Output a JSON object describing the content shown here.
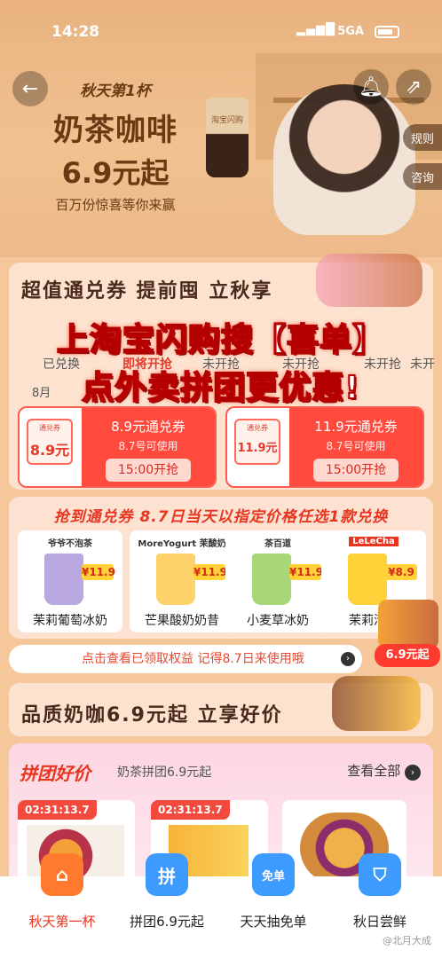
{
  "status": {
    "time": "14:28",
    "network": "5GA"
  },
  "hero": {
    "line1": "秋天第1杯",
    "line2": "奶茶咖啡",
    "line3": "6.9元起",
    "line4": "百万份惊喜等你来赢",
    "cup_text": "淘宝闪购",
    "rules": "规则",
    "consult": "咨询"
  },
  "section1": {
    "title": "超值通兑券 提前囤 立秋享",
    "tabs": [
      "已兑换",
      "即将开抢",
      "未开抢",
      "未开抢",
      "未开抢",
      "未开"
    ],
    "date_prefix": "8月"
  },
  "overlay": {
    "line1": "上淘宝闪购搜【喜单】",
    "line2": "点外卖拼团更优惠!"
  },
  "coupons": [
    {
      "mini": "通兑券",
      "value": "8.9元",
      "name": "8.9元通兑券",
      "sub": "8.7号可使用",
      "btn": "15:00开抢"
    },
    {
      "mini": "通兑券",
      "value": "11.9元",
      "name": "11.9元通兑券",
      "sub": "8.7号可使用",
      "btn": "15:00开抢"
    }
  ],
  "redeem_banner": "抢到通兑券 8.7日当天以指定价格任选1款兑换",
  "products": [
    {
      "brand": "爷爷不泡茶",
      "price": "¥11.9",
      "name": "茉莉葡萄冰奶",
      "color": "#b9a7e0"
    },
    {
      "brand": "MoreYogurt 茉酸奶",
      "price": "¥11.9",
      "name": "芒果酸奶奶昔",
      "color": "#ffd36b"
    },
    {
      "brand": "茶百道",
      "price": "¥11.9",
      "name": "小麦草冰奶",
      "color": "#a8d77a"
    },
    {
      "brand": "LeLeCha",
      "price": "¥8.9",
      "name": "茉莉清饮",
      "color": "#ffd23a"
    }
  ],
  "notice": "点击查看已领取权益 记得8.7日来使用哦",
  "badge": "6.9元起",
  "section2": {
    "title": "品质奶咖6.9元起 立享好价"
  },
  "group": {
    "title": "拼团好价",
    "subtitle": "奶茶拼团6.9元起",
    "view_all": "查看全部",
    "timers": [
      "02:31:13.7",
      "02:31:13.7",
      ""
    ]
  },
  "bottom_nav": [
    {
      "label": "秋天第一杯",
      "icon": "cup-icon",
      "color": "#ff7a2e",
      "active": true
    },
    {
      "label": "拼团6.9元起",
      "icon": "group-icon",
      "color": "#3d9bff",
      "active": false
    },
    {
      "label": "天天抽免单",
      "icon": "ticket-icon",
      "color": "#3d9bff",
      "active": false
    },
    {
      "label": "秋日尝鲜",
      "icon": "basket-icon",
      "color": "#3d9bff",
      "active": false
    }
  ],
  "nav_glyphs": [
    "⌂",
    "拼",
    "免单",
    "⛉"
  ],
  "watermark": "@北月大成"
}
